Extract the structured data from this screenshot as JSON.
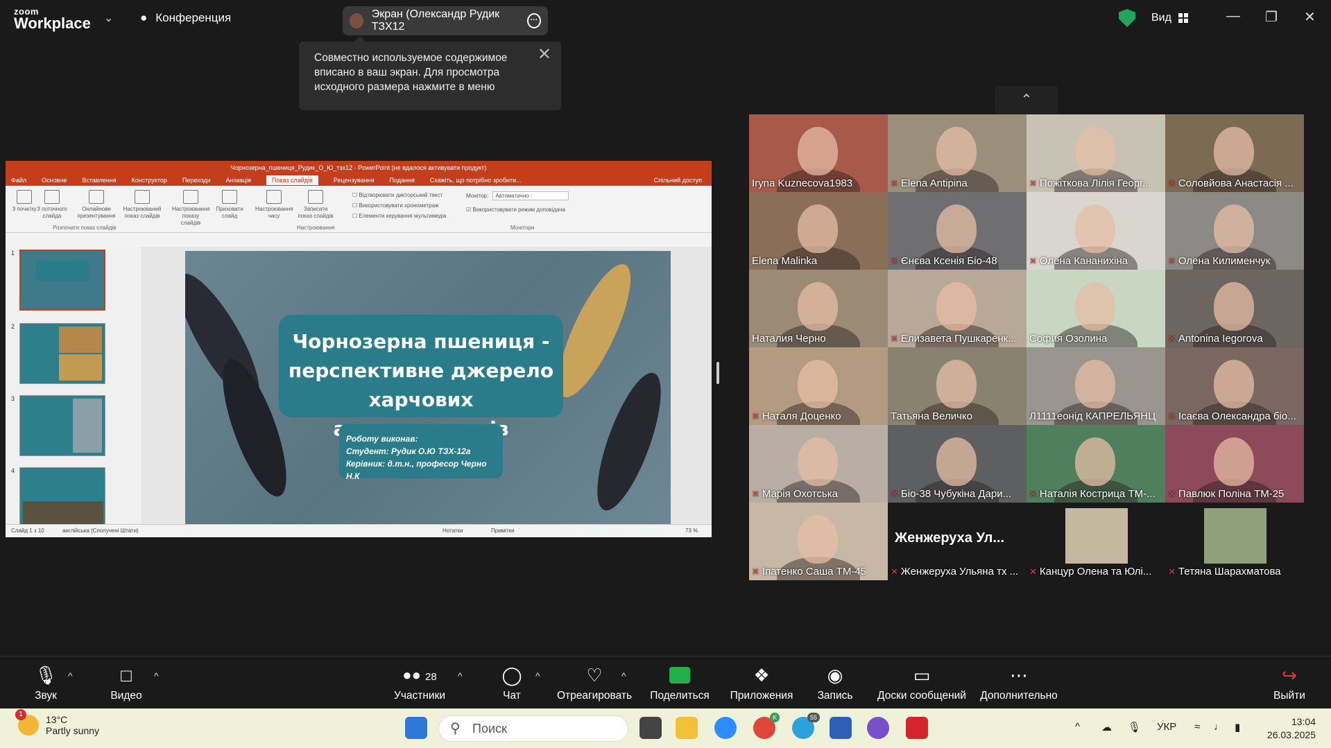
{
  "topbar": {
    "brand_top": "zoom",
    "brand_bottom": "Workplace",
    "conference_label": "Конференция",
    "screen_share_label": "Экран (Олександр Рудик ТЗХ12",
    "view_label": "Вид"
  },
  "tooltip": {
    "text": "Совместно используемое содержимое вписано в ваш экран. Для просмотра исходного размера нажмите в меню"
  },
  "ppt": {
    "title": "Чорнозерна_пшениця_Рудик_О_Ю_тзх12 - PowerPoint (не вдалося активувати продукт)",
    "tabs": [
      "Файл",
      "Основне",
      "Вставлення",
      "Конструктор",
      "Переходи",
      "Анімація",
      "Показ слайдів",
      "Рецензування",
      "Подання",
      "Скажіть, що потрібно зробити..."
    ],
    "share_label": "Спільний доступ",
    "ribbon_buttons": [
      "З початку",
      "З поточного слайда",
      "Онлайнове презентування",
      "Настроюваний показ слайдів",
      "Настроювання показу слайдів",
      "Приховати слайд",
      "Настроювання часу",
      "Записати показ слайдів"
    ],
    "ribbon_checks": [
      "Відтворювати дикторський текст",
      "Використовувати хронометраж",
      "Елементи керування мультимедіа",
      "Використовувати режим доповідача"
    ],
    "monitor_label": "Монітор:",
    "monitor_value": "Автоматично",
    "groups": [
      "Розпочати показ слайдів",
      "Настроювання",
      "Монітори"
    ],
    "thumb_numbers": [
      "1",
      "2",
      "3",
      "4"
    ],
    "slide": {
      "title_line1": "Чорнозерна пшениця -",
      "title_line2": "перспективне джерело",
      "title_line3": "харчових антиоксидантів",
      "sub_line1": "Роботу виконав:",
      "sub_line2": "Студент: Рудик О.Ю ТЗХ-12а",
      "sub_line3": "Керівник: д.т.н., професор Черно Н.К"
    },
    "status_left": "Слайд 1 з 10",
    "status_lang": "англійська (Сполучені Штати)",
    "status_notes": "Нотатки",
    "status_comments": "Примітки",
    "zoom": "73 %"
  },
  "participants": [
    {
      "name": "Iryna Kuznecova1983",
      "muted": false,
      "bg": "#a85a4a"
    },
    {
      "name": "Elena Antipina",
      "muted": true,
      "bg": "#9b8e7b"
    },
    {
      "name": "Пожіткова Лілія Георг...",
      "muted": true,
      "bg": "#c8c2b5"
    },
    {
      "name": "Соловйова Анастасія ...",
      "muted": true,
      "bg": "#7d6a55"
    },
    {
      "name": "Elena Malinka",
      "muted": false,
      "bg": "#8a6e58"
    },
    {
      "name": "Єнєва Ксенія Біо-48",
      "muted": true,
      "bg": "#6f6f72"
    },
    {
      "name": "Олена Кананихіна",
      "muted": true,
      "bg": "#d9d6d0"
    },
    {
      "name": "Олена Килименчук",
      "muted": true,
      "bg": "#8c8a86"
    },
    {
      "name": "Наталия Черно",
      "muted": false,
      "bg": "#9a8a76"
    },
    {
      "name": "Елизавета Пушкаренк...",
      "muted": true,
      "bg": "#b8a898"
    },
    {
      "name": "София Озолина",
      "muted": false,
      "bg": "#c9d6c2"
    },
    {
      "name": "Antonina Iegorova",
      "muted": true,
      "bg": "#6d6660"
    },
    {
      "name": "Наталя Доценко",
      "muted": true,
      "bg": "#b29b80"
    },
    {
      "name": "Татьяна Величко",
      "muted": false,
      "bg": "#8a8270"
    },
    {
      "name": "Л1111еонід КАПРЕЛЬЯНЦ",
      "muted": false,
      "bg": "#9b9590"
    },
    {
      "name": "Ісаєва Олександра біо...",
      "muted": true,
      "bg": "#7a6860"
    },
    {
      "name": "Марія Охотська",
      "muted": true,
      "bg": "#b8aea4"
    },
    {
      "name": "Біо-38 Чубукіна Дари...",
      "muted": true,
      "bg": "#5e5f60"
    },
    {
      "name": "Наталія Кострица ТМ-...",
      "muted": true,
      "bg": "#4f7f5c"
    },
    {
      "name": "Павлюк Поліна ТМ-25",
      "muted": true,
      "bg": "#8c4a5a"
    },
    {
      "name": "Іпатенко Саша ТМ-45",
      "muted": true,
      "bg": "#c6b8a4"
    },
    {
      "name": "Женжеруха Ульяна тх ...",
      "muted": true,
      "bg": "#1a1a1a",
      "big": "Женжеруха Ул..."
    },
    {
      "name": "Канцур Олена та Юлі...",
      "muted": true,
      "bg": "#1a1a1a",
      "photo": "#c5b8a0"
    },
    {
      "name": "Тетяна Шарахматова",
      "muted": true,
      "bg": "#1a1a1a",
      "photo": "#8fa07a"
    }
  ],
  "toolbar": {
    "audio": "Звук",
    "video": "Видео",
    "participants": "Участники",
    "participants_count": "28",
    "chat": "Чат",
    "react": "Отреагировать",
    "share": "Поделиться",
    "apps": "Приложения",
    "record": "Запись",
    "boards": "Доски сообщений",
    "more": "Дополнительно",
    "leave": "Выйти"
  },
  "taskbar": {
    "temp": "13°C",
    "weather": "Partly sunny",
    "weather_badge": "1",
    "search_placeholder": "Поиск",
    "lang": "УКР",
    "time": "13:04",
    "date": "26.03.2025",
    "chrome_badge": "K",
    "telegram_badge": "55"
  }
}
